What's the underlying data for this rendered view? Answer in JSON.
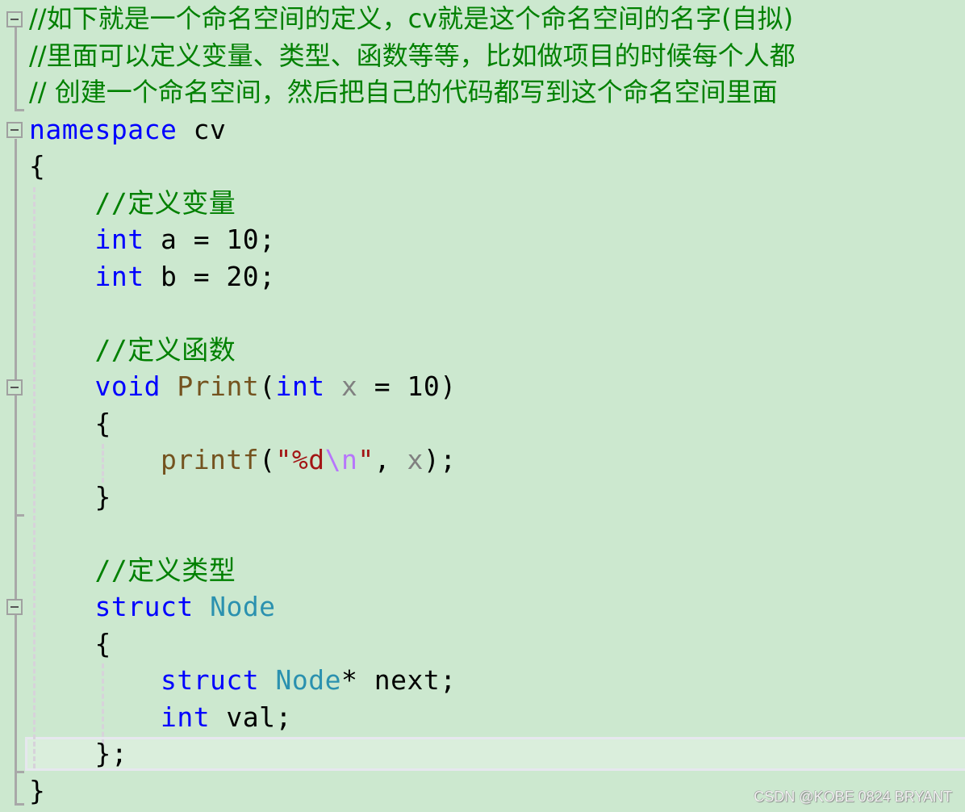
{
  "editor": {
    "colors": {
      "background": "#cce8cf",
      "comment": "#008000",
      "keyword": "#0000ff",
      "function": "#74531f",
      "type": "#2b91af",
      "parameter": "#808080",
      "string": "#a31515",
      "escape": "#b776fb"
    },
    "lines": [
      {
        "tokens": [
          {
            "t": "cm",
            "v": "//如下就是一个命名空间的定义，cv就是这个命名空间的名字(自拟)"
          }
        ]
      },
      {
        "tokens": [
          {
            "t": "cm",
            "v": "//里面可以定义变量、类型、函数等等，比如做项目的时候每个人都"
          }
        ]
      },
      {
        "tokens": [
          {
            "t": "cm",
            "v": "// 创建一个命名空间，然后把自己的代码都写到这个命名空间里面"
          }
        ]
      },
      {
        "tokens": [
          {
            "t": "kw",
            "v": "namespace"
          },
          {
            "t": "",
            "v": " cv"
          }
        ]
      },
      {
        "tokens": [
          {
            "t": "",
            "v": "{"
          }
        ]
      },
      {
        "tokens": [
          {
            "t": "cm",
            "v": "    //定义变量"
          }
        ]
      },
      {
        "tokens": [
          {
            "t": "",
            "v": "    "
          },
          {
            "t": "kw",
            "v": "int"
          },
          {
            "t": "",
            "v": " a = 10;"
          }
        ]
      },
      {
        "tokens": [
          {
            "t": "",
            "v": "    "
          },
          {
            "t": "kw",
            "v": "int"
          },
          {
            "t": "",
            "v": " b = 20;"
          }
        ]
      },
      {
        "tokens": []
      },
      {
        "tokens": [
          {
            "t": "cm",
            "v": "    //定义函数"
          }
        ]
      },
      {
        "tokens": [
          {
            "t": "",
            "v": "    "
          },
          {
            "t": "kw",
            "v": "void"
          },
          {
            "t": "",
            "v": " "
          },
          {
            "t": "fn",
            "v": "Print"
          },
          {
            "t": "",
            "v": "("
          },
          {
            "t": "kw",
            "v": "int"
          },
          {
            "t": "",
            "v": " "
          },
          {
            "t": "pm",
            "v": "x"
          },
          {
            "t": "",
            "v": " = 10)"
          }
        ]
      },
      {
        "tokens": [
          {
            "t": "",
            "v": "    {"
          }
        ]
      },
      {
        "tokens": [
          {
            "t": "",
            "v": "        "
          },
          {
            "t": "fn",
            "v": "printf"
          },
          {
            "t": "",
            "v": "("
          },
          {
            "t": "st",
            "v": "\"%d"
          },
          {
            "t": "es",
            "v": "\\n"
          },
          {
            "t": "st",
            "v": "\""
          },
          {
            "t": "",
            "v": ", "
          },
          {
            "t": "pm",
            "v": "x"
          },
          {
            "t": "",
            "v": ");"
          }
        ]
      },
      {
        "tokens": [
          {
            "t": "",
            "v": "    }"
          }
        ]
      },
      {
        "tokens": []
      },
      {
        "tokens": [
          {
            "t": "cm",
            "v": "    //定义类型"
          }
        ]
      },
      {
        "tokens": [
          {
            "t": "",
            "v": "    "
          },
          {
            "t": "kw",
            "v": "struct"
          },
          {
            "t": "",
            "v": " "
          },
          {
            "t": "ty",
            "v": "Node"
          }
        ]
      },
      {
        "tokens": [
          {
            "t": "",
            "v": "    {"
          }
        ]
      },
      {
        "tokens": [
          {
            "t": "",
            "v": "        "
          },
          {
            "t": "kw",
            "v": "struct"
          },
          {
            "t": "",
            "v": " "
          },
          {
            "t": "ty",
            "v": "Node"
          },
          {
            "t": "",
            "v": "* next;"
          }
        ]
      },
      {
        "tokens": [
          {
            "t": "",
            "v": "        "
          },
          {
            "t": "kw",
            "v": "int"
          },
          {
            "t": "",
            "v": " val;"
          }
        ]
      },
      {
        "tokens": [
          {
            "t": "",
            "v": "    };"
          }
        ]
      },
      {
        "tokens": [
          {
            "t": "",
            "v": "}"
          }
        ]
      }
    ],
    "current_line": 21,
    "fold_markers": [
      1,
      4,
      11,
      17
    ]
  },
  "watermark": "CSDN @KOBE 0824 BRYANT"
}
